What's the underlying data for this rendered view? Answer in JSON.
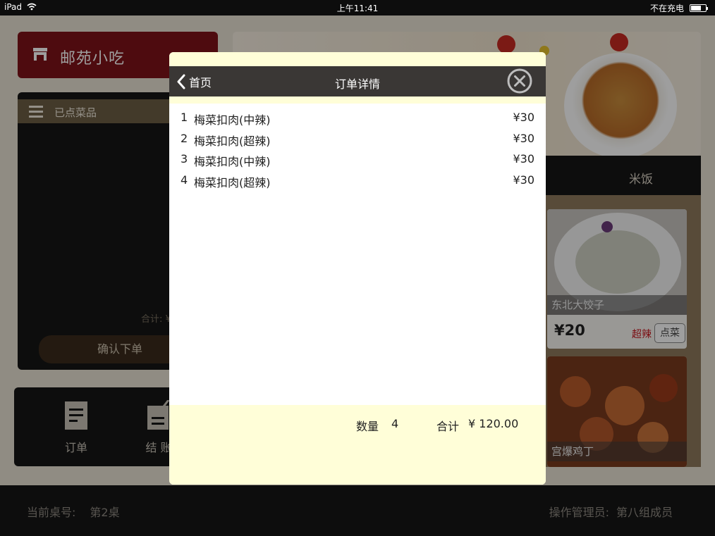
{
  "status_bar": {
    "device": "iPad",
    "time": "上午11:41",
    "charging": "不在充电"
  },
  "app": {
    "name": "邮苑小吃"
  },
  "ordered_panel": {
    "title": "已点菜品",
    "subtotal_label": "合计: ¥",
    "confirm_button": "确认下单"
  },
  "bottom_nav": {
    "orders": "订单",
    "checkout": "结 账"
  },
  "category": {
    "label": "米饭"
  },
  "foods": [
    {
      "name": "东北大饺子",
      "price": "¥20",
      "spicy": "超辣",
      "order_button": "点菜"
    },
    {
      "name": "宫爆鸡丁"
    }
  ],
  "footer": {
    "table_label": "当前桌号:",
    "table_value": "第2桌",
    "operator_label": "操作管理员:",
    "operator_value": "第八组成员"
  },
  "modal": {
    "back_label": "首页",
    "title": "订单详情",
    "items": [
      {
        "index": "1",
        "name": "梅菜扣肉(中辣)",
        "price": "¥30"
      },
      {
        "index": "2",
        "name": "梅菜扣肉(超辣)",
        "price": "¥30"
      },
      {
        "index": "3",
        "name": "梅菜扣肉(中辣)",
        "price": "¥30"
      },
      {
        "index": "4",
        "name": "梅菜扣肉(超辣)",
        "price": "¥30"
      }
    ],
    "quantity_label": "数量",
    "quantity_value": "4",
    "total_label": "合计",
    "total_value": "¥ 120.00"
  },
  "colors": {
    "brand": "#7e1219",
    "modal_header": "#3a3735",
    "modal_accent": "#fffed8",
    "spicy": "#c8151e"
  }
}
